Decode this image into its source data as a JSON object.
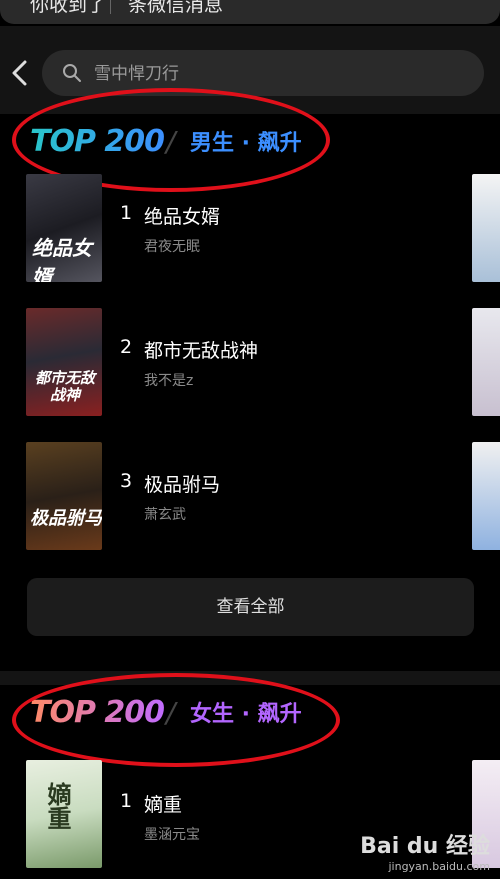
{
  "notification": {
    "left": "你收到了",
    "right": "条微信消息"
  },
  "search": {
    "placeholder": "雪中悍刀行"
  },
  "sections": [
    {
      "logo": "TOP 200",
      "subtitle": "男生 · 飙升",
      "books": [
        {
          "rank": "1",
          "title": "绝品女婿",
          "author": "君夜无眠",
          "cover_text": "绝品女婿"
        },
        {
          "rank": "2",
          "title": "都市无敌战神",
          "author": "我不是z",
          "cover_text": "都市无敌战神"
        },
        {
          "rank": "3",
          "title": "极品驸马",
          "author": "萧玄武",
          "cover_text": "极品驸马"
        }
      ],
      "view_all": "查看全部"
    },
    {
      "logo": "TOP 200",
      "subtitle": "女生 · 飙升",
      "books": [
        {
          "rank": "1",
          "title": "嫡重",
          "author": "墨涵元宝",
          "cover_text": "嫡重"
        }
      ]
    }
  ],
  "watermark": {
    "brand": "Bai du 经验",
    "url": "jingyan.baidu.com"
  },
  "colors": {
    "male_logo_start": "#29c6c9",
    "male_logo_end": "#3c8fff",
    "male_subtitle": "#3c8fff",
    "female_logo_start": "#ff8a65",
    "female_logo_end": "#c16cff",
    "female_subtitle": "#b366ff",
    "annotation_ring": "#e0101a"
  }
}
